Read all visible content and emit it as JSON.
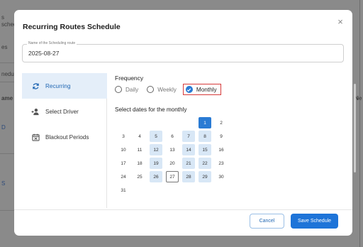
{
  "background": {
    "fragments": [
      {
        "text": "s"
      },
      {
        "text": "schedu"
      },
      {
        "text": "es"
      },
      {
        "text": "nedu"
      },
      {
        "text": "ame"
      },
      {
        "text": "Ne"
      },
      {
        "text": "D"
      },
      {
        "text": "S"
      }
    ]
  },
  "modal": {
    "title": "Recurring Routes Schedule",
    "close_icon": "×",
    "name_field": {
      "legend": "Name of the Scheduling route",
      "value": "2025-08-27"
    },
    "sidebar": {
      "items": [
        {
          "label": "Recurring",
          "icon": "sync-icon",
          "active": true
        },
        {
          "label": "Select Driver",
          "icon": "add-person-icon",
          "active": false
        },
        {
          "label": "Blackout Periods",
          "icon": "calendar-block-icon",
          "active": false
        }
      ]
    },
    "frequency": {
      "title": "Frequency",
      "options": [
        {
          "label": "Daily",
          "selected": false
        },
        {
          "label": "Weekly",
          "selected": false
        },
        {
          "label": "Monthly",
          "selected": true
        }
      ]
    },
    "calendar": {
      "instruction": "Select dates for the monthly",
      "days": [
        "1",
        "2",
        "3",
        "4",
        "5",
        "6",
        "7",
        "8",
        "9",
        "10",
        "11",
        "12",
        "13",
        "14",
        "15",
        "16",
        "17",
        "18",
        "19",
        "20",
        "21",
        "22",
        "23",
        "24",
        "25",
        "26",
        "27",
        "28",
        "29",
        "30",
        "31"
      ],
      "selected_days": [
        1
      ],
      "highlighted_days": [
        5,
        7,
        8,
        12,
        14,
        15,
        19,
        21,
        22,
        26,
        28,
        29
      ],
      "today": 27
    },
    "footer": {
      "cancel_label": "Cancel",
      "save_label": "Save Schedule"
    },
    "colors": {
      "accent": "#1e74d8",
      "selected_outline": "#d63a3a",
      "highlight": "#d8e7f6"
    }
  }
}
